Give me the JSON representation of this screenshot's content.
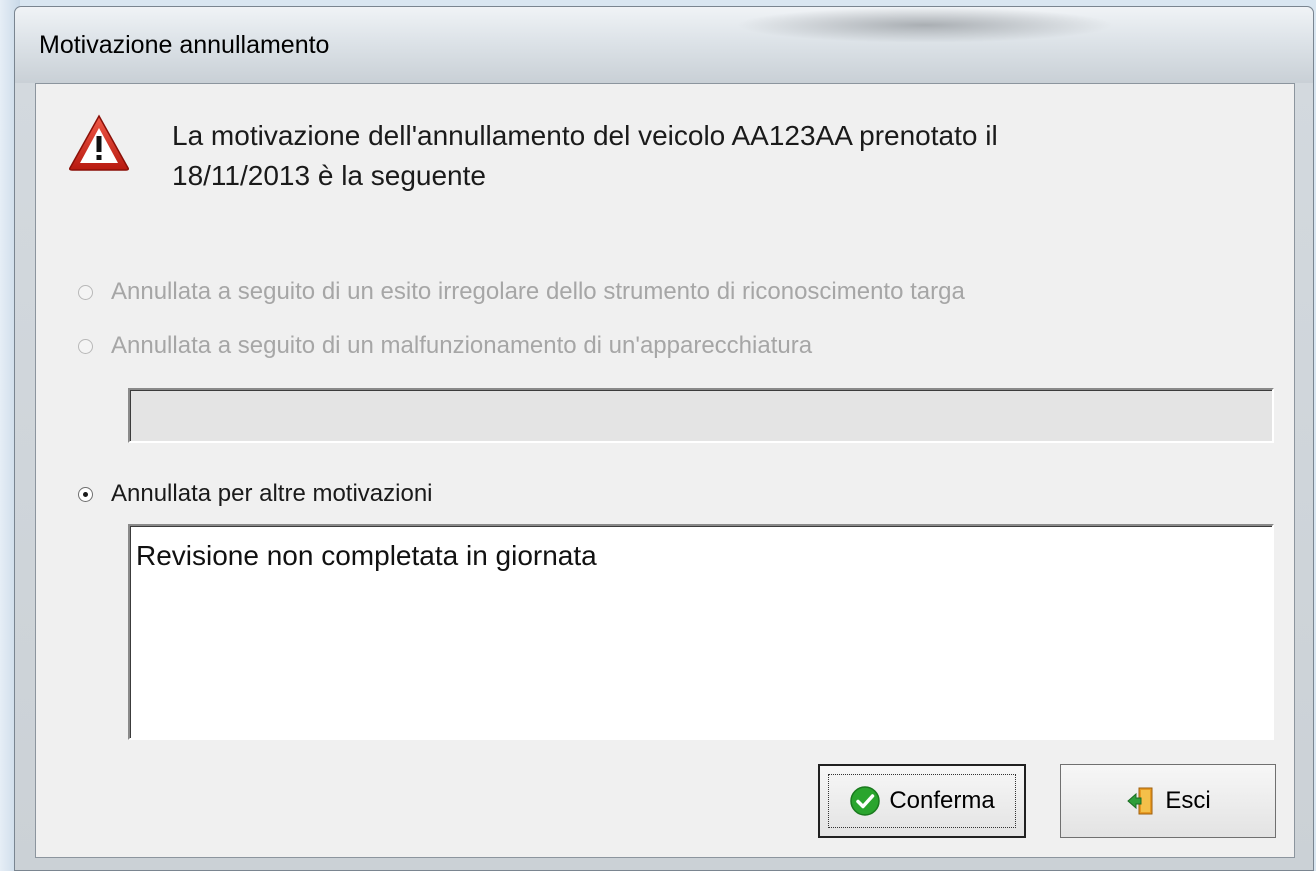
{
  "window": {
    "title": "Motivazione annullamento"
  },
  "message": {
    "line1": "La motivazione dell'annullamento del veicolo AA123AA prenotato il",
    "line2": "18/11/2013 è la seguente",
    "icon": "warning-icon"
  },
  "options": [
    {
      "label": "Annullata a seguito di un esito irregolare dello strumento di riconoscimento targa",
      "selected": false,
      "enabled": false
    },
    {
      "label": "Annullata a seguito di un malfunzionamento di un'apparecchiatura",
      "selected": false,
      "enabled": false
    },
    {
      "label": "Annullata per altre motivazioni",
      "selected": true,
      "enabled": true
    }
  ],
  "equipment_field": {
    "value": "",
    "enabled": false
  },
  "other_reason": {
    "value": "Revisione non completata in giornata"
  },
  "buttons": {
    "confirm_label": "Conferma",
    "confirm_icon": "check-icon",
    "exit_label": "Esci",
    "exit_icon": "exit-door-icon"
  },
  "colors": {
    "warning_red": "#d32a1e",
    "confirm_green": "#2aa52e",
    "disabled_text": "#a6a6a6"
  }
}
